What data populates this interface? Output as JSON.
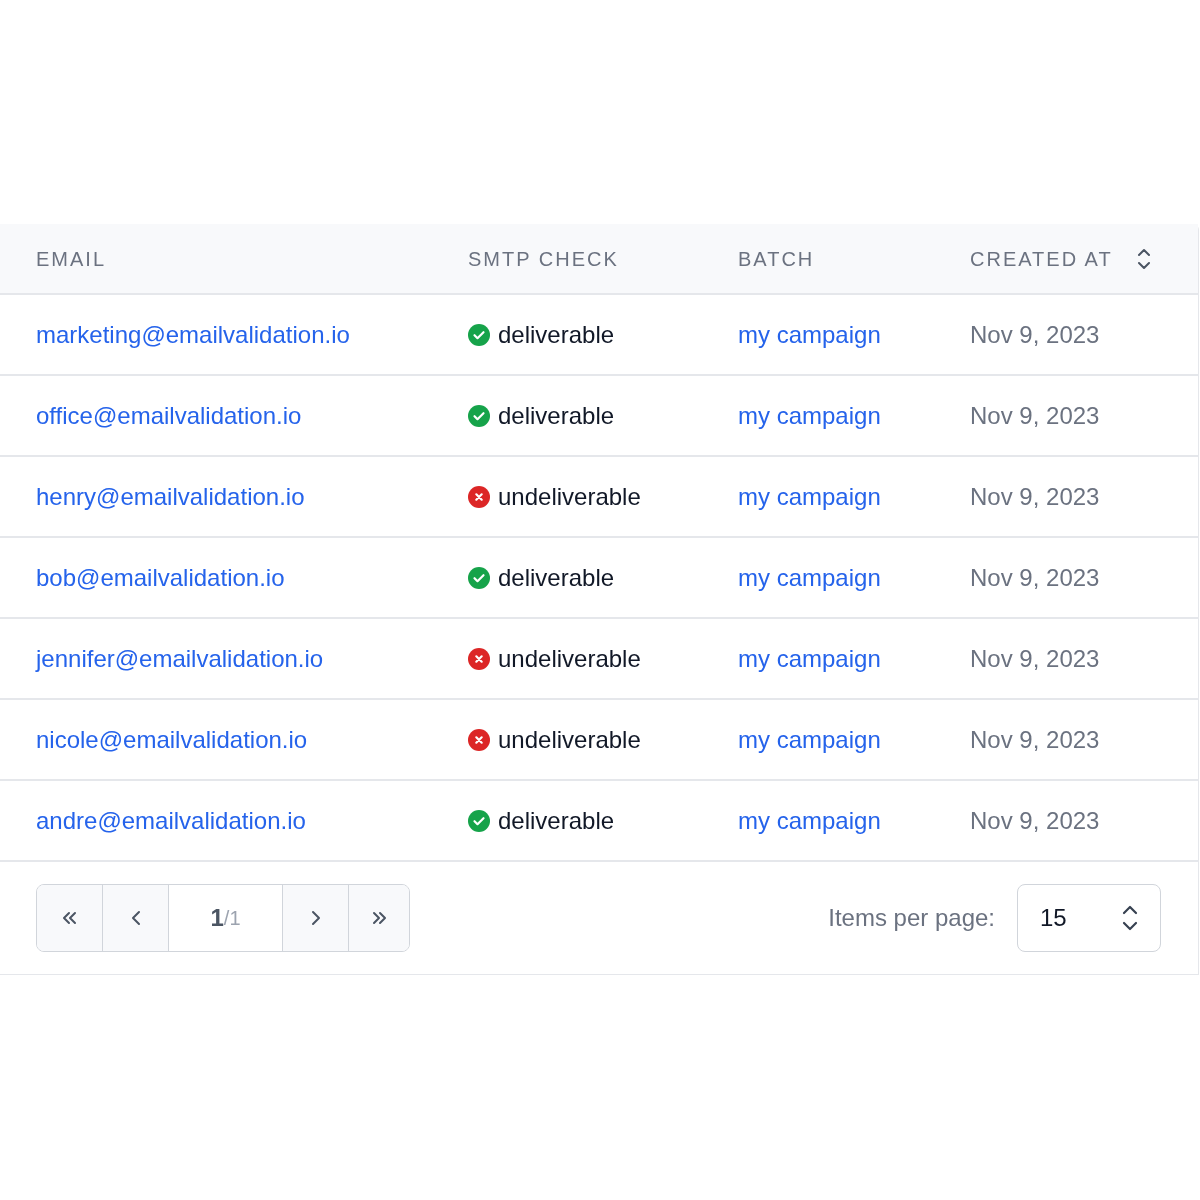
{
  "table": {
    "columns": [
      {
        "label": "EMAIL"
      },
      {
        "label": "SMTP CHECK"
      },
      {
        "label": "BATCH"
      },
      {
        "label": "CREATED AT",
        "sortable": true
      }
    ],
    "rows": [
      {
        "email": "marketing@emailvalidation.io",
        "smtp": {
          "kind": "ok",
          "text": "deliverable"
        },
        "batch": "my campaign",
        "created": "Nov 9, 2023"
      },
      {
        "email": "office@emailvalidation.io",
        "smtp": {
          "kind": "ok",
          "text": "deliverable"
        },
        "batch": "my campaign",
        "created": "Nov 9, 2023"
      },
      {
        "email": "henry@emailvalidation.io",
        "smtp": {
          "kind": "fail",
          "text": "undeliverable"
        },
        "batch": "my campaign",
        "created": "Nov 9, 2023"
      },
      {
        "email": "bob@emailvalidation.io",
        "smtp": {
          "kind": "ok",
          "text": "deliverable"
        },
        "batch": "my campaign",
        "created": "Nov 9, 2023"
      },
      {
        "email": "jennifer@emailvalidation.io",
        "smtp": {
          "kind": "fail",
          "text": "undeliverable"
        },
        "batch": "my campaign",
        "created": "Nov 9, 2023"
      },
      {
        "email": "nicole@emailvalidation.io",
        "smtp": {
          "kind": "fail",
          "text": "undeliverable"
        },
        "batch": "my campaign",
        "created": "Nov 9, 2023"
      },
      {
        "email": "andre@emailvalidation.io",
        "smtp": {
          "kind": "ok",
          "text": "deliverable"
        },
        "batch": "my campaign",
        "created": "Nov 9, 2023"
      }
    ]
  },
  "pagination": {
    "page": "1",
    "total": "/1",
    "items_per_page_label": "Items per page:",
    "items_per_page": "15"
  }
}
